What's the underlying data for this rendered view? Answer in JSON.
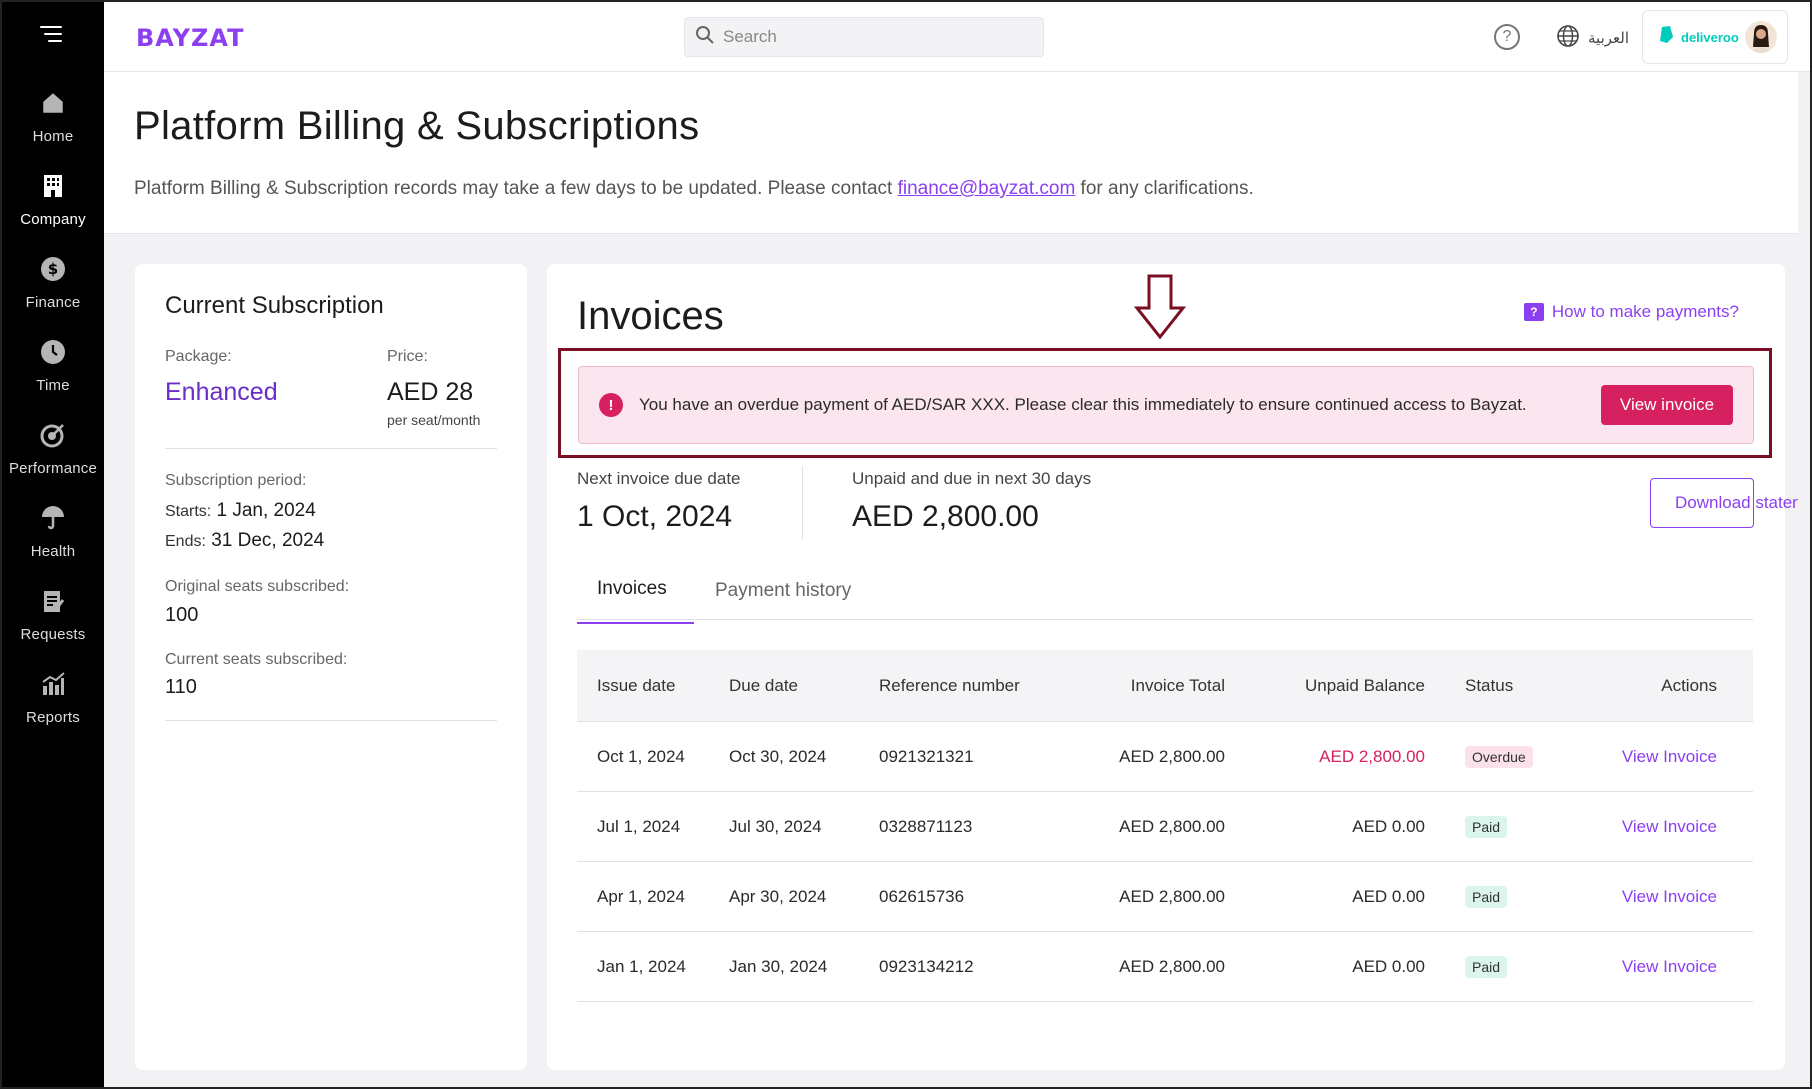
{
  "brand": {
    "logo": "BAYZAT",
    "accent": "#8b3ff0",
    "danger": "#d6205f"
  },
  "topbar": {
    "search_placeholder": "Search",
    "language": "العربية",
    "company": "deliveroo"
  },
  "sidebar": {
    "items": [
      {
        "label": "Home",
        "icon": "home-icon"
      },
      {
        "label": "Company",
        "icon": "building-icon"
      },
      {
        "label": "Finance",
        "icon": "dollar-icon"
      },
      {
        "label": "Time",
        "icon": "clock-icon"
      },
      {
        "label": "Performance",
        "icon": "target-icon"
      },
      {
        "label": "Health",
        "icon": "umbrella-icon"
      },
      {
        "label": "Requests",
        "icon": "clipboard-icon"
      },
      {
        "label": "Reports",
        "icon": "chart-icon"
      }
    ]
  },
  "page": {
    "title": "Platform Billing & Subscriptions",
    "desc_before": "Platform Billing & Subscription records may take a few days to be updated. Please contact ",
    "desc_email": "finance@bayzat.com",
    "desc_after": " for any clarifications."
  },
  "subscription": {
    "title": "Current Subscription",
    "package_label": "Package:",
    "package_value": "Enhanced",
    "price_label": "Price:",
    "price_value": "AED 28",
    "price_unit": "per seat/month",
    "period_label": "Subscription period:",
    "starts_key": "Starts:",
    "starts_value": "1 Jan, 2024",
    "ends_key": "Ends:",
    "ends_value": "31 Dec, 2024",
    "original_seats_label": "Original seats subscribed:",
    "original_seats_value": "100",
    "current_seats_label": "Current seats subscribed:",
    "current_seats_value": "110"
  },
  "invoices": {
    "title": "Invoices",
    "howto": "How to make payments?",
    "alert_message": "You have an overdue payment of AED/SAR XXX. Please clear this immediately to ensure continued access to Bayzat.",
    "alert_button": "View invoice",
    "next_due_label": "Next invoice due date",
    "next_due_value": "1 Oct, 2024",
    "unpaid_label": "Unpaid and due in next 30 days",
    "unpaid_value": "AED 2,800.00",
    "download_label": "Download statement",
    "tabs": [
      "Invoices",
      "Payment history"
    ],
    "columns": [
      "Issue date",
      "Due date",
      "Reference number",
      "Invoice Total",
      "Unpaid Balance",
      "Status",
      "Actions"
    ],
    "rows": [
      {
        "issue": "Oct 1, 2024",
        "due": "Oct 30, 2024",
        "ref": "0921321321",
        "total": "AED 2,800.00",
        "unpaid": "AED 2,800.00",
        "status": "Overdue",
        "action": "View Invoice"
      },
      {
        "issue": "Jul 1, 2024",
        "due": "Jul 30, 2024",
        "ref": "0328871123",
        "total": "AED 2,800.00",
        "unpaid": "AED 0.00",
        "status": "Paid",
        "action": "View Invoice"
      },
      {
        "issue": "Apr 1, 2024",
        "due": "Apr 30, 2024",
        "ref": "062615736",
        "total": "AED 2,800.00",
        "unpaid": "AED 0.00",
        "status": "Paid",
        "action": "View Invoice"
      },
      {
        "issue": "Jan 1, 2024",
        "due": "Jan 30, 2024",
        "ref": "0923134212",
        "total": "AED 2,800.00",
        "unpaid": "AED 0.00",
        "status": "Paid",
        "action": "View Invoice"
      }
    ]
  }
}
